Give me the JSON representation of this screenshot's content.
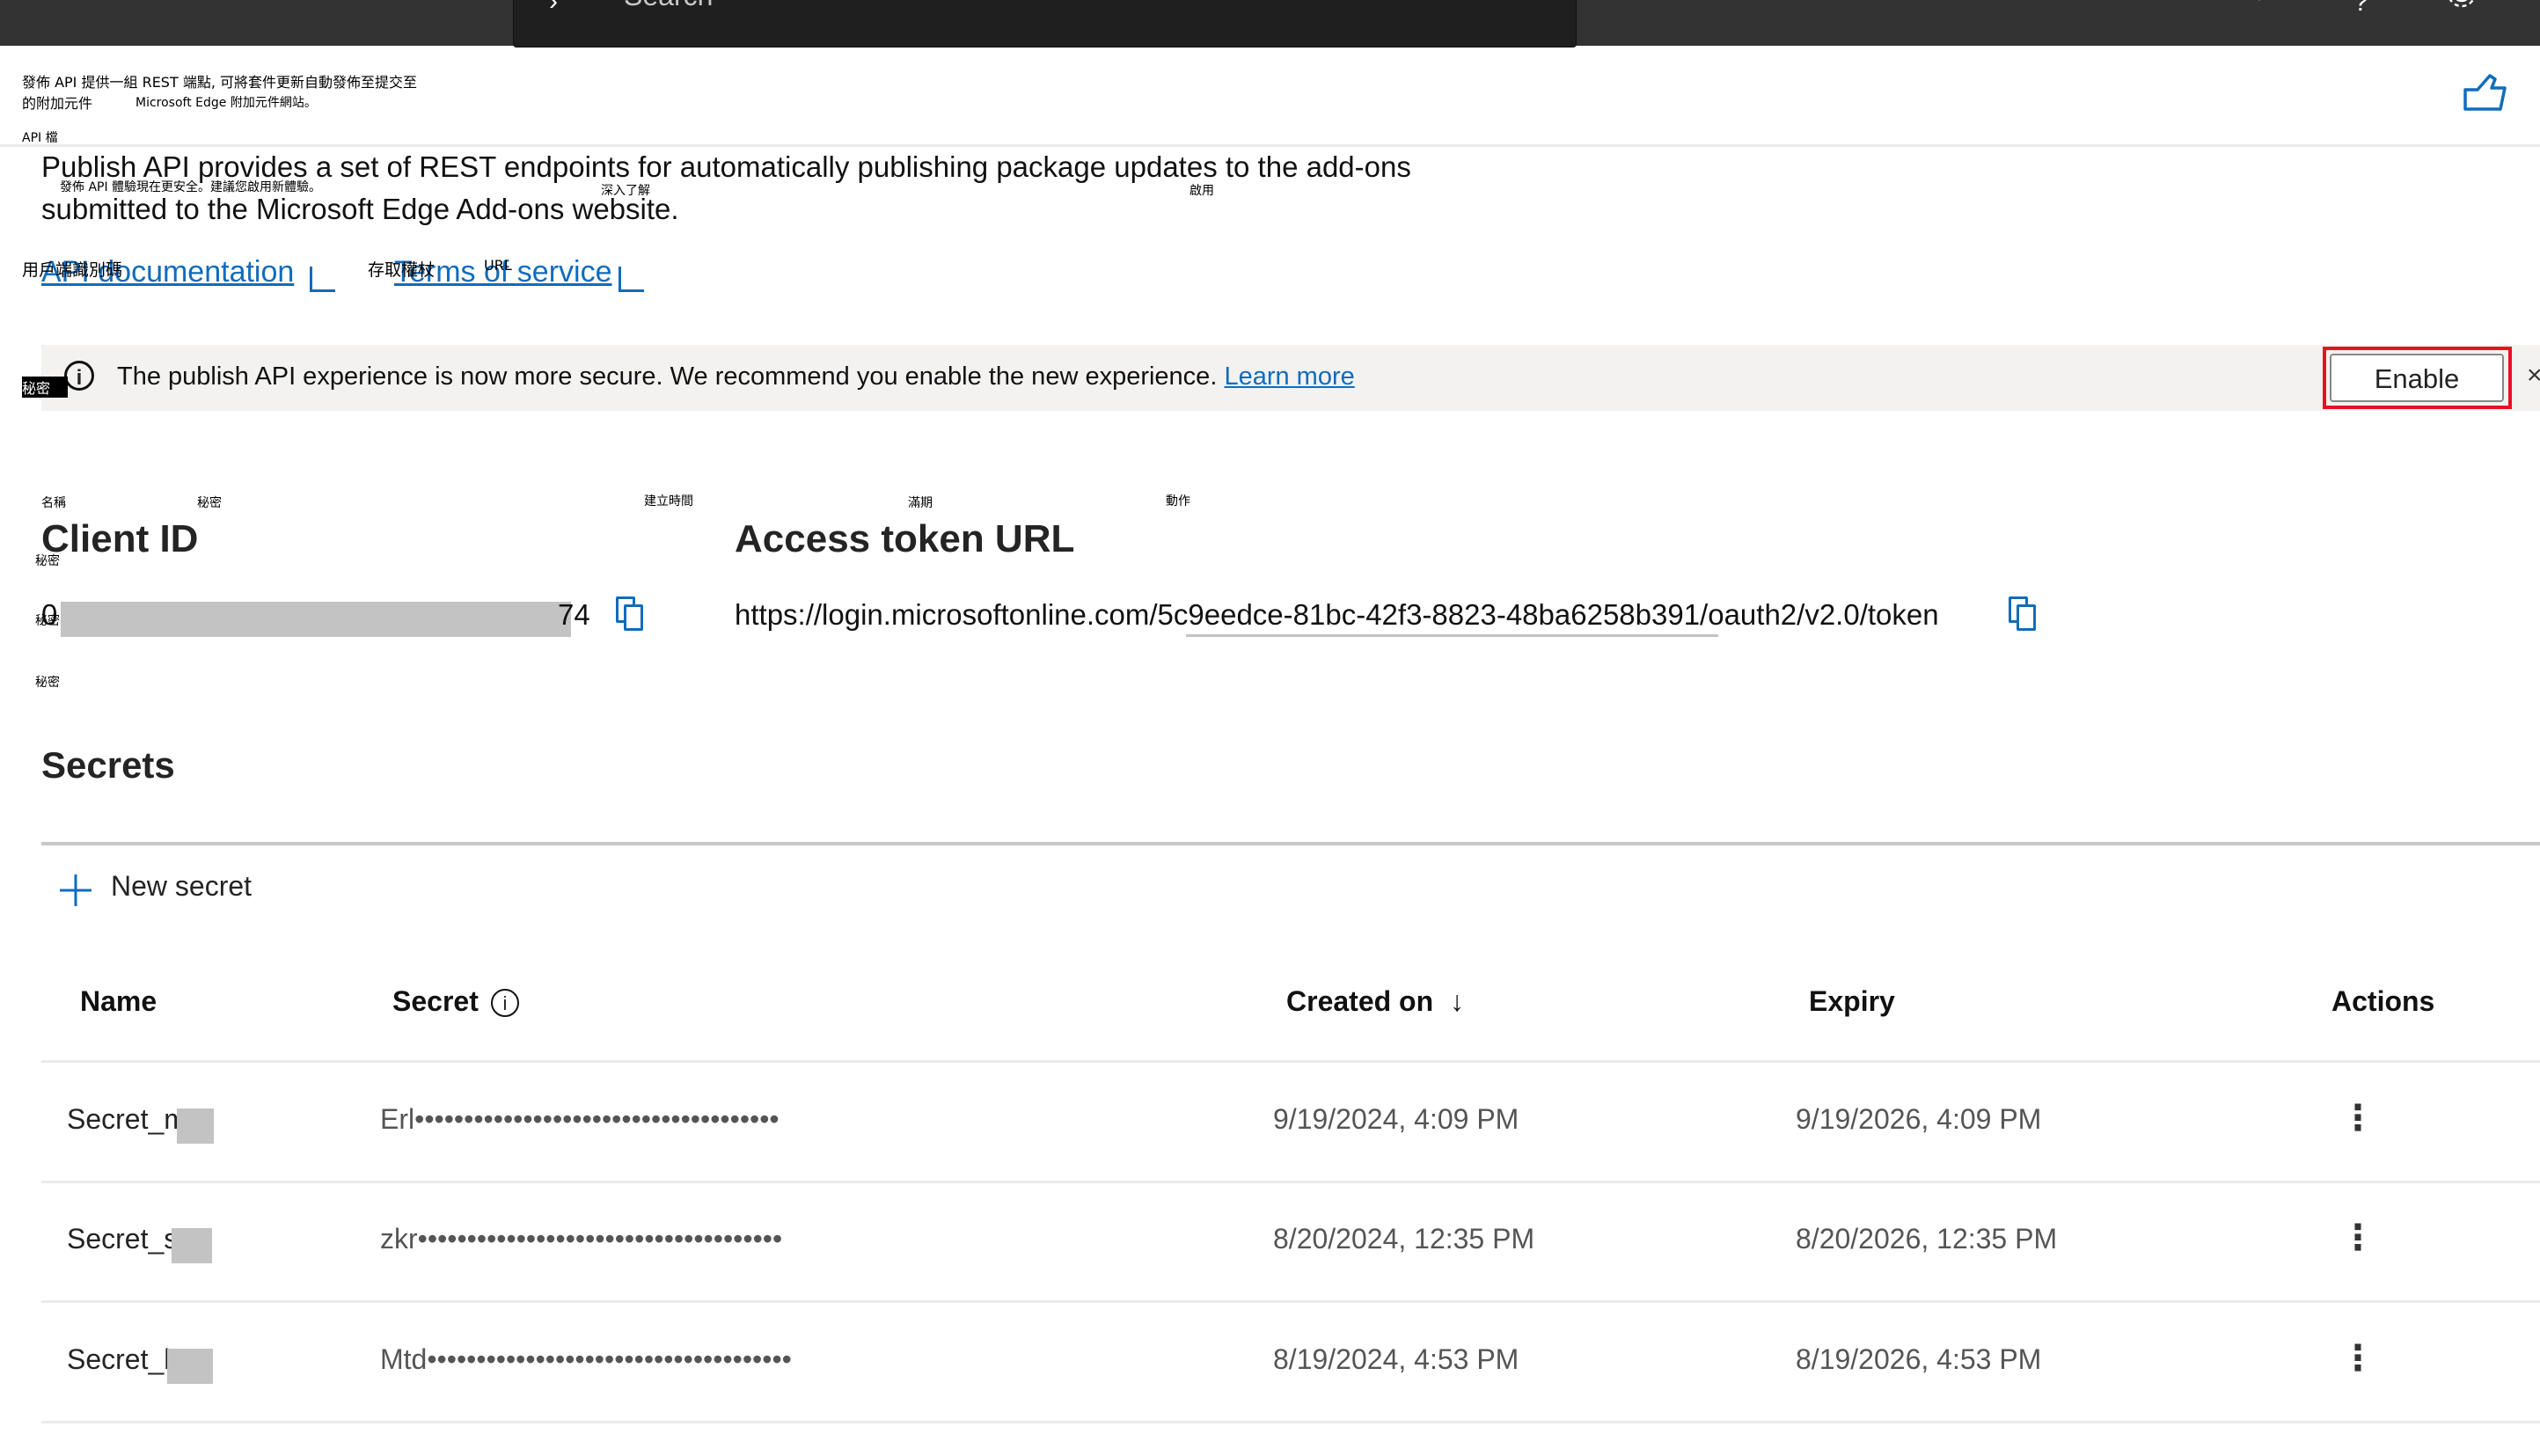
{
  "topbar": {
    "search_placeholder": "Search",
    "search_chevron": "›",
    "icons": [
      "bell-icon",
      "help-icon",
      "gear-icon"
    ],
    "help_glyph": "?"
  },
  "annotations": {
    "desc_cjk_line1": "發佈 API 提供一組 REST 端點, 可將套件更新自動發佈至提交至",
    "desc_cjk_line2a": "的附加元件",
    "desc_cjk_line2b": "Microsoft Edge 附加元件網站。",
    "api_doc_cjk": "API 檔",
    "banner_cjk": "發佈 API 體驗現在更安全。建議您啟用新體驗。",
    "learn_more_cjk": "深入了解",
    "enable_cjk": "啟用",
    "client_id_cjk": "用戶端識別碼",
    "access_token_cjk": "存取權杖",
    "url_cjk": "URL",
    "secret_cjk": "秘密",
    "col_name_cjk": "名稱",
    "col_secret_cjk": "秘密",
    "col_created_cjk": "建立時間",
    "col_expiry_cjk": "滿期",
    "col_actions_cjk": "動作"
  },
  "description": {
    "line1": "Publish API provides a set of REST endpoints for automatically publishing package updates to the add-ons",
    "line2": "submitted to the Microsoft Edge Add-ons website."
  },
  "links": {
    "api_documentation": "API documentation",
    "terms_of_service": "Terms of service"
  },
  "banner": {
    "message": "The publish API experience is now more secure. We recommend you enable the new experience.",
    "learn_more": "Learn more",
    "enable_button": "Enable",
    "close_glyph": "×",
    "info_glyph": "i"
  },
  "credentials": {
    "client_id_label": "Client ID",
    "client_id_prefix": "0",
    "client_id_suffix": "74",
    "access_token_label": "Access token URL",
    "access_token_url": "https://login.microsoftonline.com/5c9eedce-81bc-42f3-8823-48ba6258b391/oauth2/v2.0/token"
  },
  "secrets": {
    "heading": "Secrets",
    "new_secret": "New secret",
    "columns": {
      "name": "Name",
      "secret": "Secret",
      "created_on": "Created on",
      "sort_glyph": "↓",
      "expiry": "Expiry",
      "actions": "Actions"
    },
    "rows": [
      {
        "name": "Secret_m",
        "secret": "Erl•••••••••••••••••••••••••••••••••••••",
        "created": "9/19/2024, 4:09 PM",
        "expiry": "9/19/2026, 4:09 PM"
      },
      {
        "name": "Secret_s",
        "secret": "zkr•••••••••••••••••••••••••••••••••••••",
        "created": "8/20/2024, 12:35 PM",
        "expiry": "8/20/2026, 12:35 PM"
      },
      {
        "name": "Secret_b",
        "secret": "Mtd•••••••••••••••••••••••••••••••••••••",
        "created": "8/19/2024, 4:53 PM",
        "expiry": "8/19/2026, 4:53 PM"
      }
    ],
    "kebab_glyph": "⋮"
  },
  "colors": {
    "accent": "#0f6cbd",
    "highlight_outline": "#e81123",
    "topbar": "#333333",
    "banner_bg": "#f3f2f1"
  }
}
